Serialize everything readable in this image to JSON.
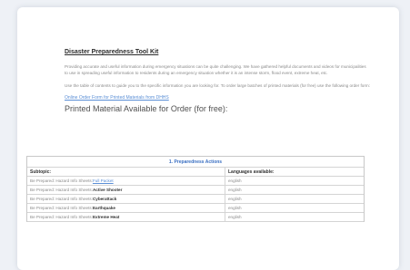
{
  "doc": {
    "title": "Disaster Preparedness Tool Kit",
    "para1": "Providing accurate and useful information during emergency situations can be quite challenging. We have gathered helpful documents and videos for municipalities to use in spreading useful information to residents during an emergency situation whether it is an intense storm, flood event, extreme heat, etc.",
    "para2": "Use the table of contents to guide you to the specific information you are looking for. To order large batches of printed materials (for free) use the following order form:",
    "order_link": "Online Order Form for Printed Materials from DHHS",
    "subheading": "Printed Material Available for Order (for free):"
  },
  "table": {
    "section_title": "1.   Preparedness Actions",
    "col_subtopic": "Subtopic:",
    "col_languages": "Languages available:",
    "rows": [
      {
        "prefix": "Be Prepared: Hazard Info Sheets: ",
        "topic": "Full Packet",
        "is_link": true,
        "language": "english"
      },
      {
        "prefix": "Be Prepared: Hazard Info Sheets: ",
        "topic": "Active Shooter",
        "is_link": false,
        "language": "english"
      },
      {
        "prefix": "Be Prepared: Hazard Info Sheets: ",
        "topic": "Cyberattack",
        "is_link": false,
        "language": "english"
      },
      {
        "prefix": "Be Prepared: Hazard Info Sheets: ",
        "topic": "Earthquake",
        "is_link": false,
        "language": "english"
      },
      {
        "prefix": "Be Prepared: Hazard Info Sheets: ",
        "topic": "Extreme Heat",
        "is_link": false,
        "language": "english"
      }
    ]
  },
  "colors": {
    "background": "#eef1f6",
    "link": "#5b8fd6",
    "section_title": "#3a6fc2"
  }
}
